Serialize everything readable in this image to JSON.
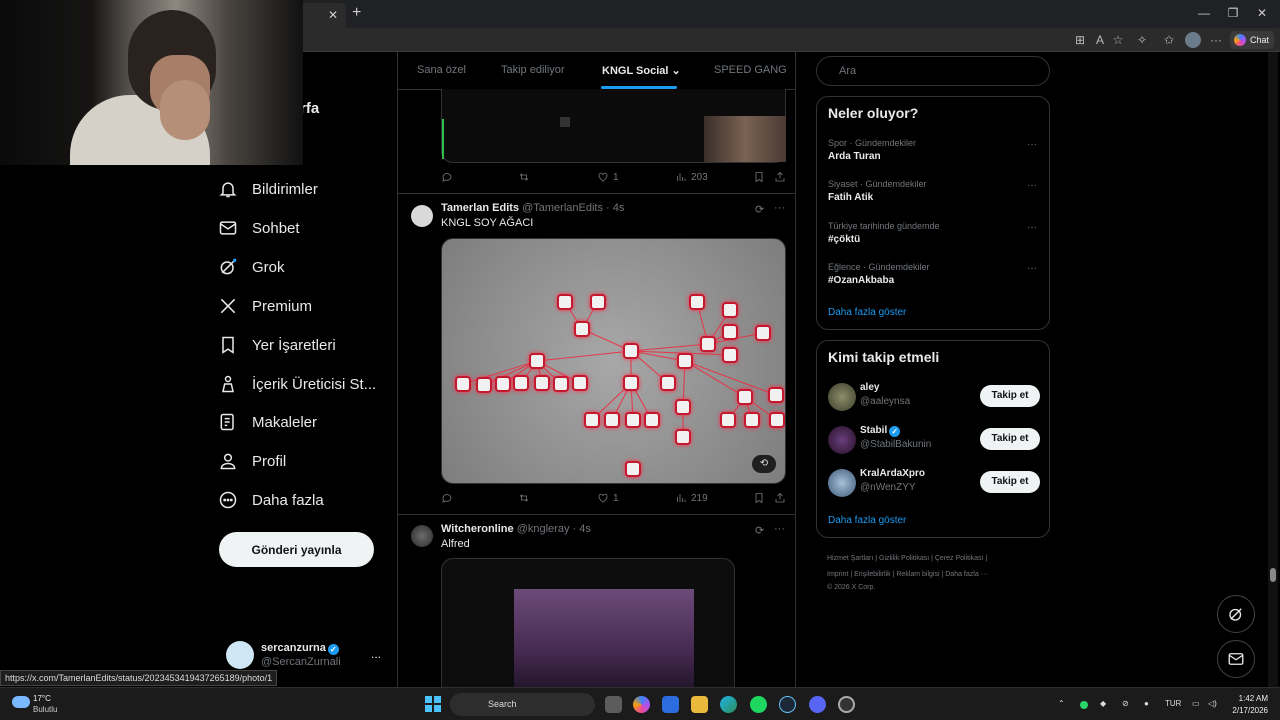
{
  "feed_tabs": [
    "Sana özel",
    "Takip ediliyor",
    "KNGL Social",
    "SPEED GANG"
  ],
  "nav": {
    "partial_label": "rfa",
    "items": [
      {
        "label": "Bildirimler",
        "icon": "bell-icon"
      },
      {
        "label": "Sohbet",
        "icon": "envelope-icon"
      },
      {
        "label": "Grok",
        "icon": "grok-icon"
      },
      {
        "label": "Premium",
        "icon": "x-logo-icon"
      },
      {
        "label": "Yer İşaretleri",
        "icon": "bookmark-icon"
      },
      {
        "label": "İçerik Üreticisi St...",
        "icon": "creator-studio-icon"
      },
      {
        "label": "Makaleler",
        "icon": "article-icon"
      },
      {
        "label": "Profil",
        "icon": "person-icon"
      },
      {
        "label": "Daha fazla",
        "icon": "more-circle-icon"
      }
    ],
    "post_button": "Gönderi yayınla"
  },
  "account": {
    "name": "sercanzurna",
    "handle": "@SercanZurnali",
    "more": "..."
  },
  "tweets": [
    {
      "replies": "",
      "retweets": "",
      "likes": "1",
      "views": "203"
    },
    {
      "author": "Tamerlan Edits",
      "handle": "@TamerlanEdits",
      "time": "· 4s",
      "text": "KNGL SOY AĞACI",
      "replies": "",
      "retweets": "",
      "likes": "1",
      "views": "219",
      "more": "···"
    },
    {
      "author": "Witcheronline",
      "handle": "@kngleray",
      "time": "· 4s",
      "text": "Alfred",
      "more": "···"
    }
  ],
  "search": {
    "placeholder": "Ara"
  },
  "trends": {
    "title": "Neler oluyor?",
    "items": [
      {
        "category": "Spor · Gündemdekiler",
        "name": "Arda Turan"
      },
      {
        "category": "Siyaset · Gündemdekiler",
        "name": "Fatih Atik"
      },
      {
        "category": "Türkiye tarihinde gündemde",
        "name": "#çöktü"
      },
      {
        "category": "Eğlence · Gündemdekiler",
        "name": "#OzanAkbaba"
      }
    ],
    "dots": "···",
    "show_more": "Daha fazla göster"
  },
  "who_to_follow": {
    "title": "Kimi takip etmeli",
    "users": [
      {
        "name": "aley",
        "handle": "@aaleynsa",
        "button": "Takip et",
        "verified": false
      },
      {
        "name": "Stabil",
        "handle": "@StabilBakunin",
        "button": "Takip et",
        "verified": true
      },
      {
        "name": "KralArdaXpro",
        "handle": "@nWenZYY",
        "button": "Takip et",
        "verified": false
      }
    ],
    "show_more": "Daha fazla göster"
  },
  "footer": {
    "line1": "Hizmet Şartları  |  Gizlilik Politikası  |  Çerez Politikası  |",
    "line2": "Imprint  |  Erişilebilirlik  |  Reklam bilgisi  |  Daha fazla ···",
    "line3": "© 2026 X Corp."
  },
  "status_url": "https://x.com/TamerlanEdits/status/2023453419437265189/photo/1",
  "browser": {
    "chat_label": "Chat"
  },
  "taskbar": {
    "temperature": "17°C",
    "weather": "Bulutlu",
    "search_label": "Search",
    "language": "TUR",
    "time": "1:42 AM",
    "date": "2/17/2026"
  },
  "alt_badge": "⟲",
  "colors": {
    "accent": "#1d9bf0",
    "background": "#000000",
    "border": "#2f3336",
    "muted": "#71767b"
  }
}
